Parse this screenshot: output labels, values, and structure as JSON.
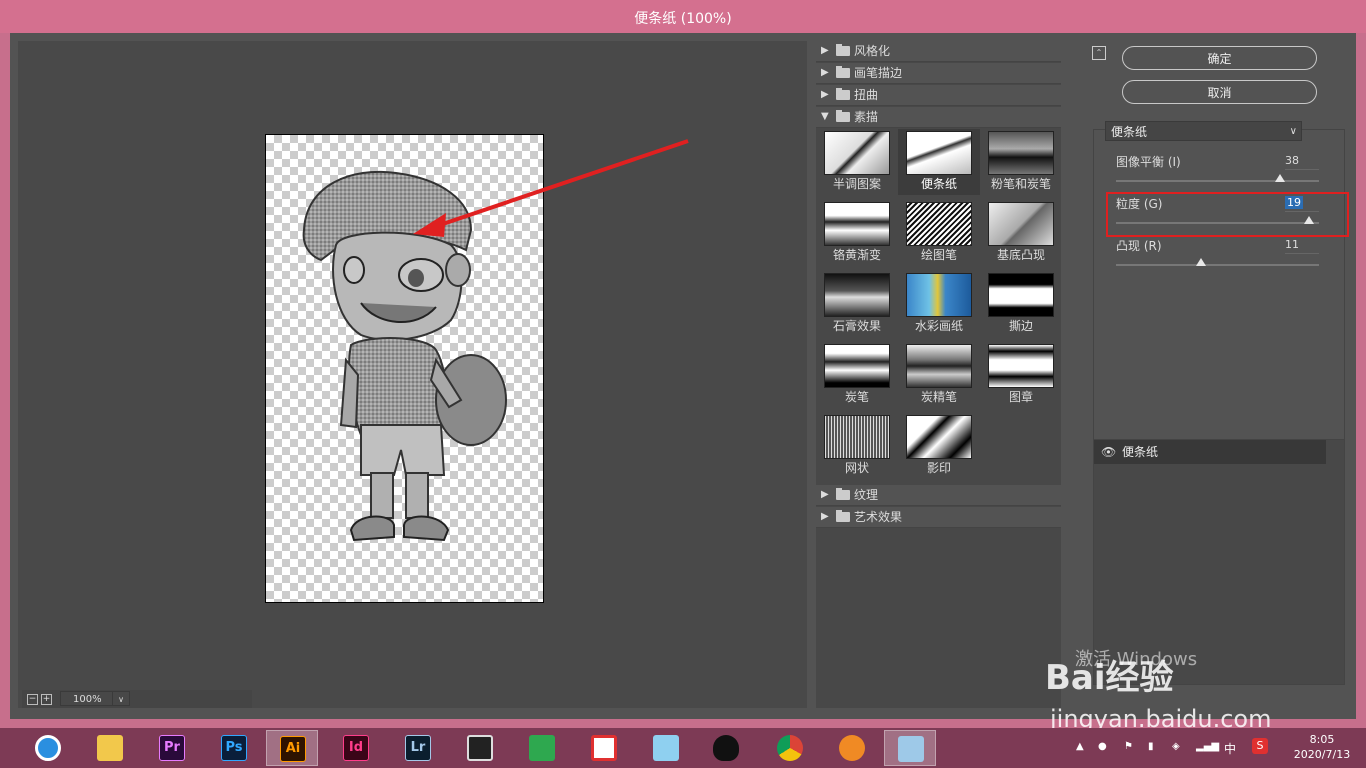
{
  "window": {
    "title": "便条纸 (100%)"
  },
  "preview": {
    "zoom": "100%"
  },
  "filters": {
    "categories_top": [
      "风格化",
      "画笔描边",
      "扭曲"
    ],
    "open_category": "素描",
    "items": [
      "半调图案",
      "便条纸",
      "粉笔和炭笔",
      "铬黄渐变",
      "绘图笔",
      "基底凸现",
      "石膏效果",
      "水彩画纸",
      "撕边",
      "炭笔",
      "炭精笔",
      "图章",
      "网状",
      "影印"
    ],
    "selected": "便条纸",
    "categories_bottom": [
      "纹理",
      "艺术效果"
    ]
  },
  "buttons": {
    "ok": "确定",
    "cancel": "取消"
  },
  "settings": {
    "filter": "便条纸",
    "sliders": [
      {
        "label": "图像平衡 (I)",
        "value": "38",
        "fraction": 0.81
      },
      {
        "label": "粒度 (G)",
        "value": "19",
        "fraction": 0.95
      },
      {
        "label": "凸现 (R)",
        "value": "11",
        "fraction": 0.42
      }
    ]
  },
  "layers": {
    "item": "便条纸"
  },
  "watermark": {
    "line": "激活 Windows",
    "brand": "Bai经验",
    "url": "jingyan.baidu.com"
  },
  "taskbar": {
    "apps": [
      "Pr",
      "Ps",
      "Ai",
      "Id",
      "Lr"
    ],
    "tray_input": "中",
    "time": "8:05",
    "date": "2020/7/13"
  },
  "colors": {
    "title_bar": "#d4708f",
    "dialog": "#535353",
    "highlight": "#e02020",
    "taskbar": "#7d3a55"
  }
}
